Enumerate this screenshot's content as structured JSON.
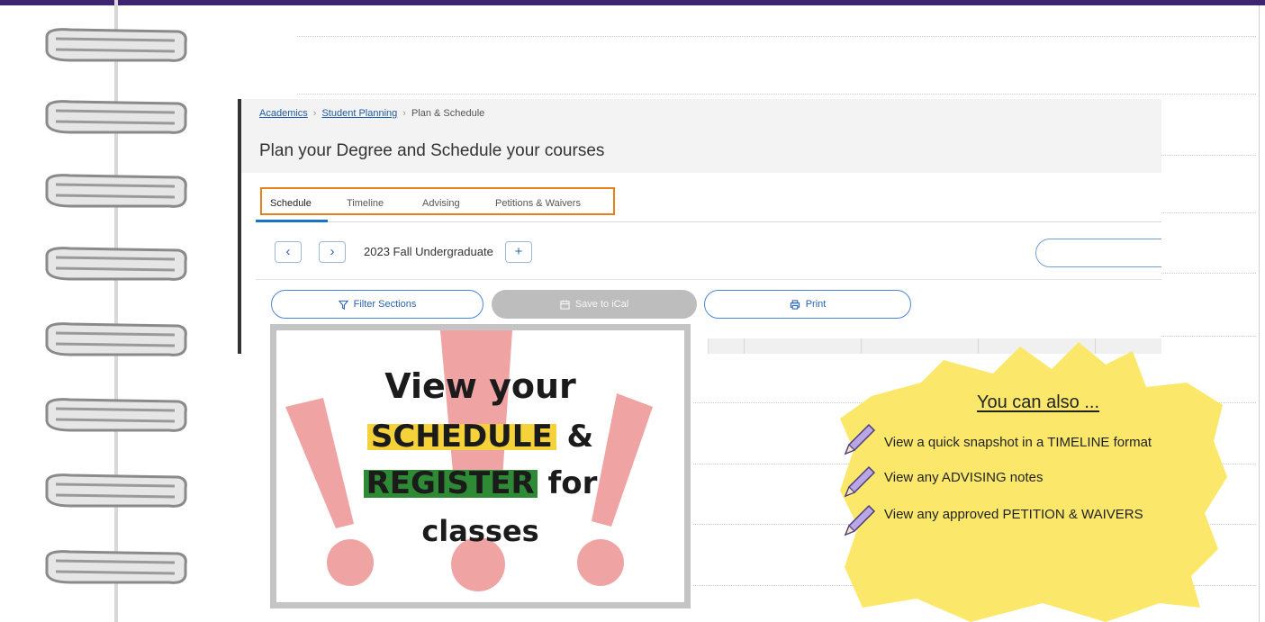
{
  "colors": {
    "top_bar": "#3e2571",
    "tab_highlight_border": "#e8801c",
    "link_blue": "#1f5aa0",
    "highlight_yellow": "#f5d23a",
    "highlight_green": "#2f8a35",
    "exclamation_pink": "#f0a3a3",
    "blob_yellow": "#fbe86a",
    "pencil_purple": "#b9a6e6"
  },
  "screenshot": {
    "breadcrumb": {
      "items": [
        "Academics",
        "Student Planning",
        "Plan & Schedule"
      ],
      "separator": "›"
    },
    "page_title": "Plan your Degree and Schedule your courses",
    "tabs": [
      {
        "label": "Schedule",
        "active": true
      },
      {
        "label": "Timeline",
        "active": false
      },
      {
        "label": "Advising",
        "active": false
      },
      {
        "label": "Petitions & Waivers",
        "active": false
      }
    ],
    "term_nav": {
      "prev_icon": "‹",
      "next_icon": "›",
      "term_label": "2023 Fall Undergraduate",
      "add_icon": "+"
    },
    "actions": {
      "filter_label": "Filter Sections",
      "filter_icon": "filter-icon",
      "ical_label": "Save to iCal",
      "ical_icon": "calendar-icon",
      "print_label": "Print",
      "print_icon": "printer-icon"
    }
  },
  "callout": {
    "line1": "View your",
    "schedule_word": "SCHEDULE",
    "ampersand": "&",
    "register_word": "REGISTER",
    "for_word": "for",
    "line4": "classes"
  },
  "also": {
    "title": "You can also ...",
    "items": [
      "View a quick snapshot in a TIMELINE format",
      "View any ADVISING notes",
      "View any approved PETITION & WAIVERS"
    ]
  }
}
